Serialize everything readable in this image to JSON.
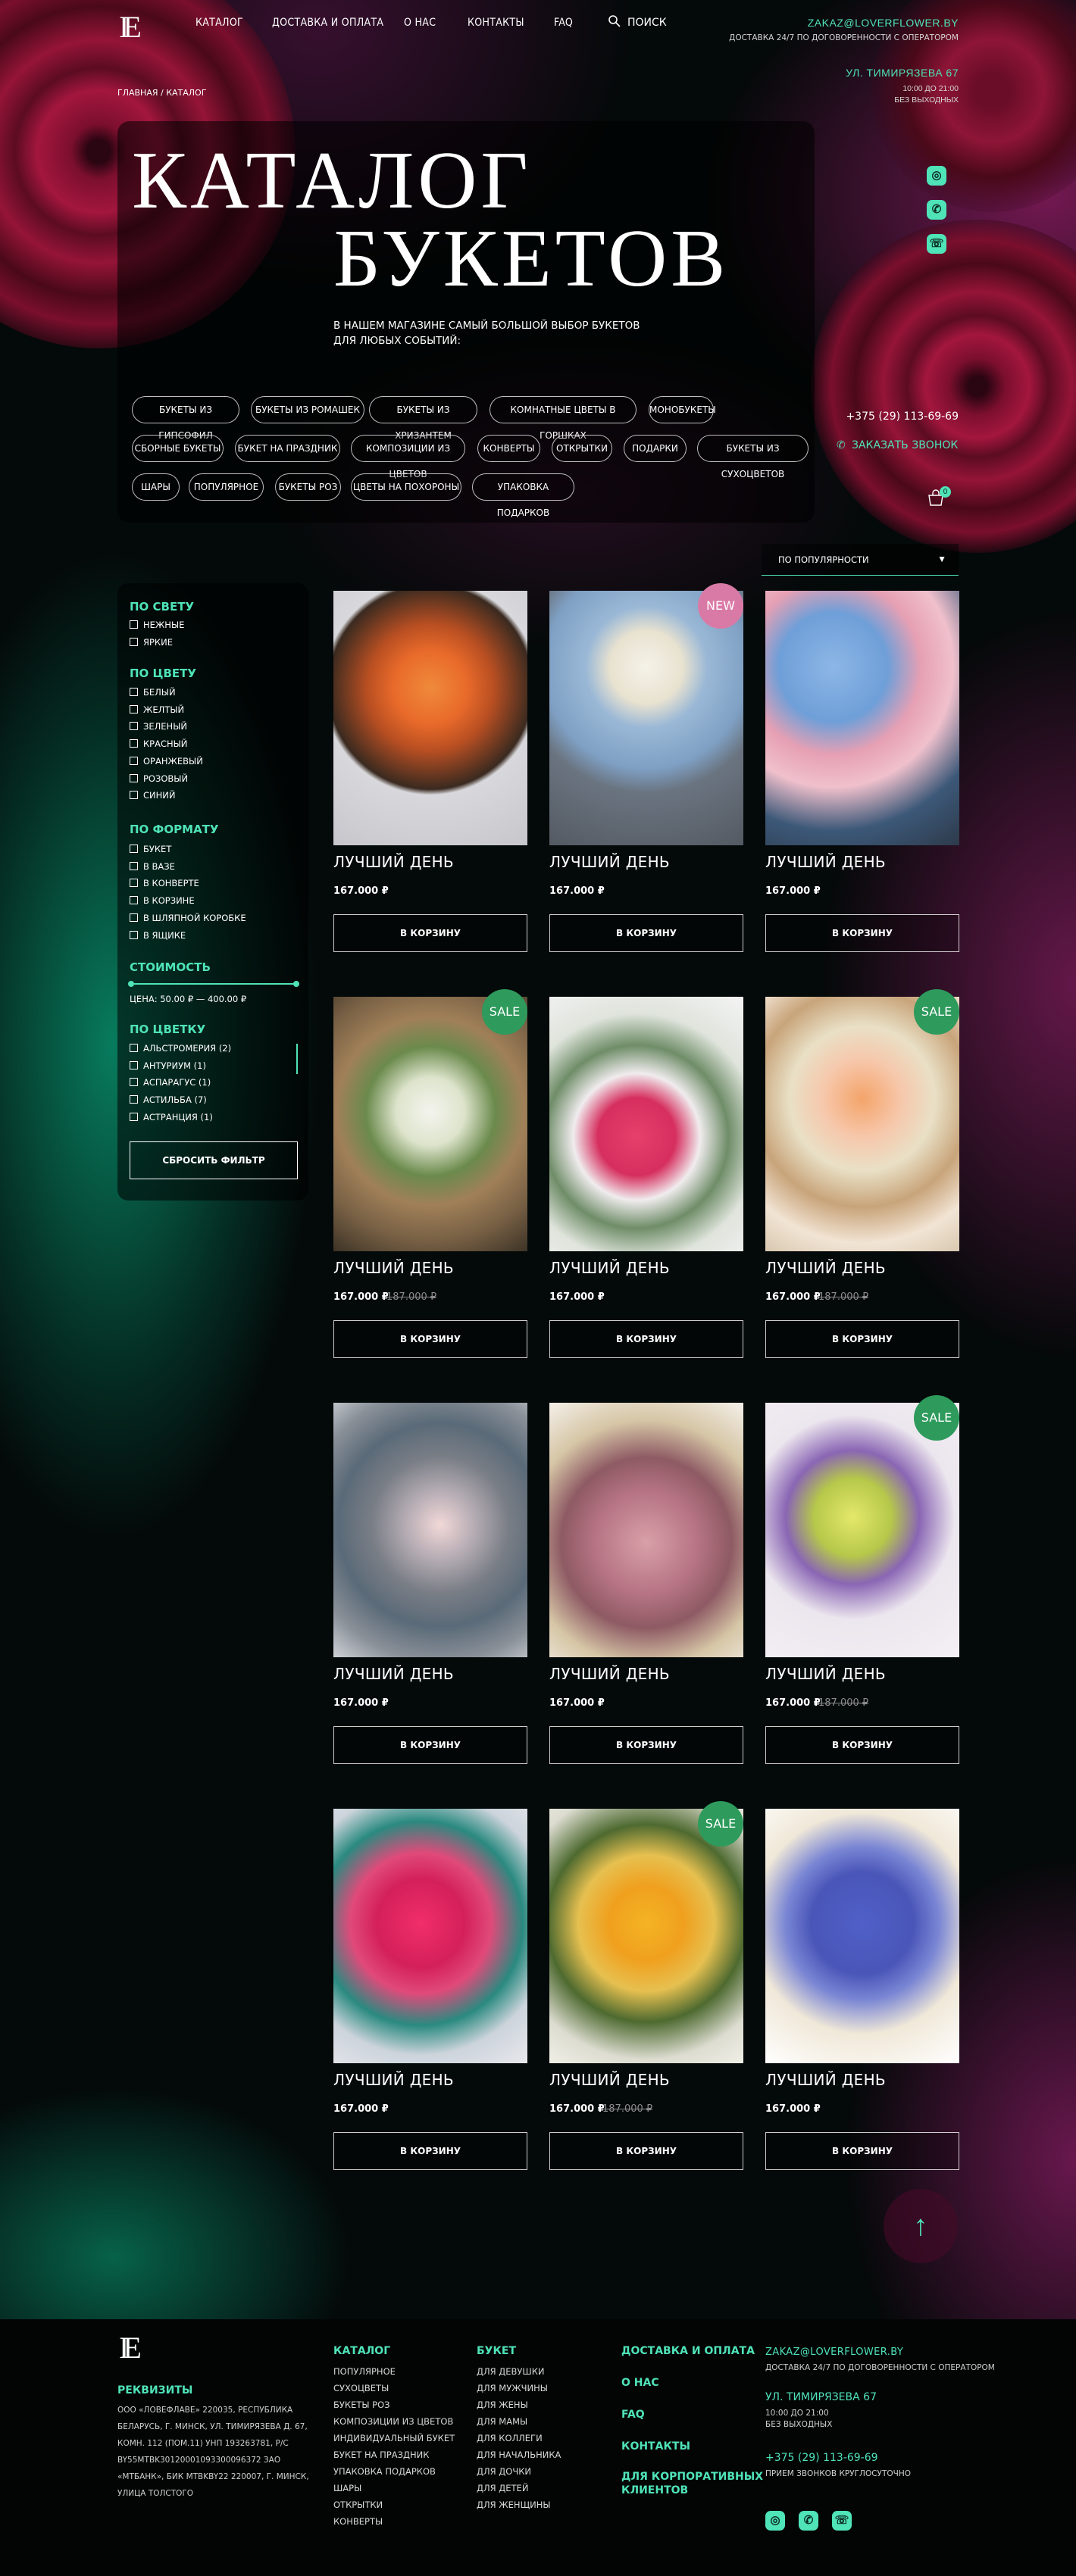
{
  "header": {
    "nav": [
      "КАТАЛОГ",
      "ДОСТАВКА И ОПЛАТА",
      "О НАС",
      "КОНТАКТЫ",
      "FAQ"
    ],
    "search": "ПОИСК",
    "email": "ZAKAZ@LOVERFLOWER.BY",
    "delivery": "ДОСТАВКА 24/7 ПО ДОГОВОРЕННОСТИ С ОПЕРАТОРОМ",
    "address": "УЛ. ТИМИРЯЗЕВА 67",
    "hours": "10:00 ДО 21:00",
    "days": "БЕЗ ВЫХОДНЫХ",
    "phone": "+375 (29) 113-69-69",
    "callback": "ЗАКАЗАТЬ ЗВОНОК",
    "cart_count": "0"
  },
  "breadcrumb": "ГЛАВНАЯ / КАТАЛОГ",
  "hero": {
    "title1": "КАТАЛОГ",
    "title2": "БУКЕТОВ",
    "subtitle": "В НАШЕМ МАГАЗИНЕ САМЫЙ БОЛЬШОЙ ВЫБОР БУКЕТОВ ДЛЯ ЛЮБЫХ СОБЫТИЙ:",
    "chips": [
      "БУКЕТЫ ИЗ ГИПСОФИЛ",
      "БУКЕТЫ ИЗ РОМАШЕК",
      "БУКЕТЫ ИЗ ХРИЗАНТЕМ",
      "КОМНАТНЫЕ ЦВЕТЫ В ГОРШКАХ",
      "МОНОБУКЕТЫ",
      "СБОРНЫЕ БУКЕТЫ",
      "БУКЕТ НА ПРАЗДНИК",
      "КОМПОЗИЦИИ ИЗ ЦВЕТОВ",
      "КОНВЕРТЫ",
      "ОТКРЫТКИ",
      "ПОДАРКИ",
      "БУКЕТЫ ИЗ СУХОЦВЕТОВ",
      "ШАРЫ",
      "ПОПУЛЯРНОЕ",
      "БУКЕТЫ РОЗ",
      "ЦВЕТЫ НА ПОХОРОНЫ",
      "УПАКОВКА ПОДАРКОВ"
    ]
  },
  "sort": "ПО ПОПУЛЯРНОСТИ",
  "filters": {
    "light_title": "ПО СВЕТУ",
    "light": [
      "НЕЖНЫЕ",
      "ЯРКИЕ"
    ],
    "color_title": "ПО ЦВЕТУ",
    "colors": [
      "БЕЛЫЙ",
      "ЖЕЛТЫЙ",
      "ЗЕЛЕНЫЙ",
      "КРАСНЫЙ",
      "ОРАНЖЕВЫЙ",
      "РОЗОВЫЙ",
      "СИНИЙ"
    ],
    "format_title": "ПО ФОРМАТУ",
    "formats": [
      "БУКЕТ",
      "В ВАЗЕ",
      "В КОНВЕРТЕ",
      "В КОРЗИНЕ",
      "В ШЛЯПНОЙ КОРОБКЕ",
      "В ЯЩИКЕ"
    ],
    "cost_title": "СТОИМОСТЬ",
    "price": "ЦЕНА: 50.00 ₽ — 400.00 ₽",
    "flower_title": "ПО ЦВЕТКУ",
    "flowers": [
      "АЛЬСТРОМЕРИЯ (2)",
      "АНТУРИУМ (1)",
      "АСПАРАГУС (1)",
      "АСТИЛЬБА (7)",
      "АСТРАНЦИЯ (1)"
    ],
    "reset": "СБРОСИТЬ ФИЛЬТР"
  },
  "products": [
    {
      "name": "ЛУЧШИЙ ДЕНЬ",
      "price": "167.000 ₽",
      "old": "",
      "badge": "",
      "btn": "В КОРЗИНУ"
    },
    {
      "name": "ЛУЧШИЙ ДЕНЬ",
      "price": "167.000 ₽",
      "old": "",
      "badge": "NEW",
      "btn": "В КОРЗИНУ"
    },
    {
      "name": "ЛУЧШИЙ ДЕНЬ",
      "price": "167.000 ₽",
      "old": "",
      "badge": "",
      "btn": "В КОРЗИНУ"
    },
    {
      "name": "ЛУЧШИЙ ДЕНЬ",
      "price": "167.000 ₽",
      "old": "187.000 ₽",
      "badge": "SALE",
      "btn": "В КОРЗИНУ"
    },
    {
      "name": "ЛУЧШИЙ ДЕНЬ",
      "price": "167.000 ₽",
      "old": "",
      "badge": "",
      "btn": "В КОРЗИНУ"
    },
    {
      "name": "ЛУЧШИЙ ДЕНЬ",
      "price": "167.000 ₽",
      "old": "187.000 ₽",
      "badge": "SALE",
      "btn": "В КОРЗИНУ"
    },
    {
      "name": "ЛУЧШИЙ ДЕНЬ",
      "price": "167.000 ₽",
      "old": "",
      "badge": "",
      "btn": "В КОРЗИНУ"
    },
    {
      "name": "ЛУЧШИЙ ДЕНЬ",
      "price": "167.000 ₽",
      "old": "",
      "badge": "",
      "btn": "В КОРЗИНУ"
    },
    {
      "name": "ЛУЧШИЙ ДЕНЬ",
      "price": "167.000 ₽",
      "old": "187.000 ₽",
      "badge": "SALE",
      "btn": "В КОРЗИНУ"
    },
    {
      "name": "ЛУЧШИЙ ДЕНЬ",
      "price": "167.000 ₽",
      "old": "",
      "badge": "",
      "btn": "В КОРЗИНУ"
    },
    {
      "name": "ЛУЧШИЙ ДЕНЬ",
      "price": "167.000 ₽",
      "old": "187.000 ₽",
      "badge": "SALE",
      "btn": "В КОРЗИНУ"
    },
    {
      "name": "ЛУЧШИЙ ДЕНЬ",
      "price": "167.000 ₽",
      "old": "",
      "badge": "",
      "btn": "В КОРЗИНУ"
    }
  ],
  "footer": {
    "req_title": "РЕКВИЗИТЫ",
    "req_lines": [
      "ООО «ЛОВЕФЛАВЕ» 220035, РЕСПУБЛИКА",
      "БЕЛАРУСЬ, Г. МИНСК, УЛ. ТИМИРЯЗЕВА Д. 67,",
      "КОМН. 112 (ПОМ.11) УНП 193263781, Р/С",
      "BY55MTBK30120001093300096372 ЗАО",
      "«МТБАНК», БИК MTBKBY22 220007, Г. МИНСК,",
      "УЛИЦА ТОЛСТОГО"
    ],
    "catalog_title": "КАТАЛОГ",
    "catalog": [
      "ПОПУЛЯРНОЕ",
      "СУХОЦВЕТЫ",
      "БУКЕТЫ РОЗ",
      "КОМПОЗИЦИИ ИЗ ЦВЕТОВ",
      "ИНДИВИДУАЛЬНЫЙ БУКЕТ",
      "БУКЕТ НА ПРАЗДНИК",
      "УПАКОВКА ПОДАРКОВ",
      "ШАРЫ",
      "ОТКРЫТКИ",
      "КОНВЕРТЫ"
    ],
    "bouquet_title": "БУКЕТ",
    "bouquet": [
      "ДЛЯ ДЕВУШКИ",
      "ДЛЯ МУЖЧИНЫ",
      "ДЛЯ ЖЕНЫ",
      "ДЛЯ МАМЫ",
      "ДЛЯ КОЛЛЕГИ",
      "ДЛЯ НАЧАЛЬНИКА",
      "ДЛЯ ДОЧКИ",
      "ДЛЯ ДЕТЕЙ",
      "ДЛЯ ЖЕНЩИНЫ"
    ],
    "links": [
      "ДОСТАВКА И ОПЛАТА",
      "О НАС",
      "FAQ",
      "КОНТАКТЫ"
    ],
    "corp1": "ДЛЯ КОРПОРАТИВНЫХ",
    "corp2": "КЛИЕНТОВ",
    "email": "ZAKAZ@LOVERFLOWER.BY",
    "delivery": "ДОСТАВКА 24/7 ПО ДОГОВОРЕННОСТИ С ОПЕРАТОРОМ",
    "address": "УЛ. ТИМИРЯЗЕВА 67",
    "hours": "10:00 ДО 21:00",
    "days": "БЕЗ ВЫХОДНЫХ",
    "phone": "+375 (29) 113-69-69",
    "calls": "ПРИЕМ ЗВОНКОВ КРУГЛОСУТОЧНО"
  },
  "colors": {
    "accent": "#4fe3b8",
    "sale": "#2e9a5c",
    "new": "#d97aa6"
  }
}
